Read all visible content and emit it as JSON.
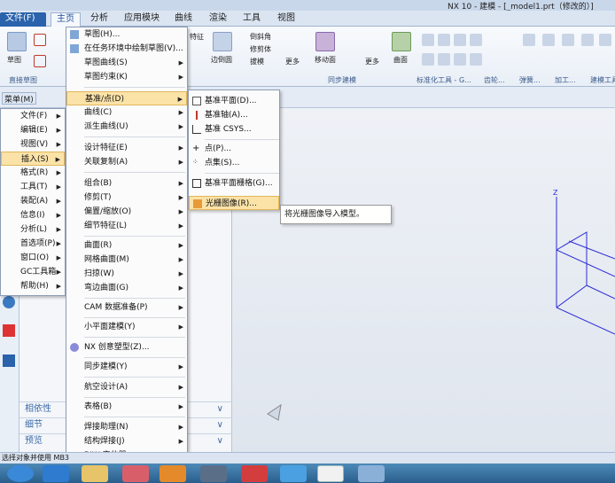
{
  "title_bar": {
    "text": "NX 10 - 建模 - [_model1.prt（修改的）]"
  },
  "tabs": [
    {
      "label": "文件(F)"
    },
    {
      "label": "主页"
    },
    {
      "label": "分析"
    },
    {
      "label": "应用模块"
    },
    {
      "label": "曲线"
    },
    {
      "label": "渲染"
    },
    {
      "label": "工具"
    },
    {
      "label": "视图"
    }
  ],
  "ribbon": {
    "labels": {
      "sketch": "草图",
      "direct_sketch": "直接草图",
      "edge_blend": "边倒圆",
      "chamfer": "倒斜角",
      "trim_body": "修剪体",
      "draft": "拔模",
      "more1": "更多",
      "move_face": "移动面",
      "more2": "更多",
      "surface": "曲面",
      "feature": "特征",
      "sync": "同步建模",
      "std_parts": "标准化工具 - G...",
      "gear": "齿轮...",
      "spring": "弹簧...",
      "machining": "加工...",
      "build": "建模工具..."
    }
  },
  "cmdbar": {
    "menu_label": "菜单(M)"
  },
  "main_menu": [
    {
      "label": "文件(F)"
    },
    {
      "label": "编辑(E)"
    },
    {
      "label": "视图(V)"
    },
    {
      "label": "插入(S)"
    },
    {
      "label": "格式(R)"
    },
    {
      "label": "工具(T)"
    },
    {
      "label": "装配(A)"
    },
    {
      "label": "信息(I)"
    },
    {
      "label": "分析(L)"
    },
    {
      "label": "首选项(P)"
    },
    {
      "label": "窗口(O)"
    },
    {
      "label": "GC工具箱"
    },
    {
      "label": "帮助(H)"
    }
  ],
  "insert_menu": [
    {
      "label": "草图(H)..."
    },
    {
      "label": "在任务环境中绘制草图(V)..."
    },
    {
      "label": "草图曲线(S)"
    },
    {
      "label": "草图约束(K)"
    },
    {
      "label": "基准/点(D)"
    },
    {
      "label": "曲线(C)"
    },
    {
      "label": "派生曲线(U)"
    },
    {
      "label": "设计特征(E)"
    },
    {
      "label": "关联复制(A)"
    },
    {
      "label": "组合(B)"
    },
    {
      "label": "修剪(T)"
    },
    {
      "label": "偏置/缩放(O)"
    },
    {
      "label": "细节特征(L)"
    },
    {
      "label": "曲面(R)"
    },
    {
      "label": "网格曲面(M)"
    },
    {
      "label": "扫掠(W)"
    },
    {
      "label": "弯边曲面(G)"
    },
    {
      "label": "CAM 数据准备(P)"
    },
    {
      "label": "小平面建模(Y)"
    },
    {
      "label": "NX 创意塑型(Z)..."
    },
    {
      "label": "同步建模(Y)"
    },
    {
      "label": "航空设计(A)"
    },
    {
      "label": "表格(B)"
    },
    {
      "label": "焊接助理(N)"
    },
    {
      "label": "结构焊接(J)"
    },
    {
      "label": "BIW 定位器"
    }
  ],
  "datum_menu": [
    {
      "label": "基准平面(D)..."
    },
    {
      "label": "基准轴(A)..."
    },
    {
      "label": "基准 CSYS..."
    },
    {
      "label": "点(P)..."
    },
    {
      "label": "点集(S)..."
    },
    {
      "label": "基准平面栅格(G)..."
    },
    {
      "label": "光栅图像(R)..."
    }
  ],
  "tooltip": {
    "text": "将光栅图像导入模型。"
  },
  "nav": {
    "sections": [
      {
        "label": "相依性"
      },
      {
        "label": "细节"
      },
      {
        "label": "预览"
      }
    ]
  },
  "status": {
    "text": "选择对象并使用 MB3"
  },
  "colors": {
    "accent": "#2a62ac",
    "highlight": "#fbe3a8",
    "axis": "#2b2bd6"
  }
}
